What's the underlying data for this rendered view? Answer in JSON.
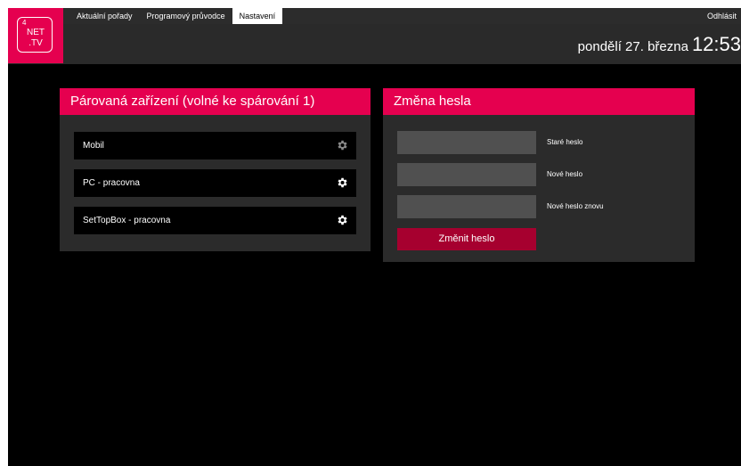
{
  "nav": {
    "tabs": [
      {
        "label": "Aktuální pořady"
      },
      {
        "label": "Programový průvodce"
      },
      {
        "label": "Nastavení"
      }
    ],
    "active_tab": "Nastavení",
    "logout_label": "Odhlásit"
  },
  "logo": {
    "number": "4",
    "line1": "NET",
    "line2": ".TV"
  },
  "clock": {
    "date": "pondělí 27. března",
    "time": "12:53"
  },
  "devices_panel": {
    "title": "Párovaná zařízení (volné ke spárování 1)",
    "devices": [
      {
        "label": "Mobil",
        "gear_state": "dimmed"
      },
      {
        "label": "PC - pracovna",
        "gear_state": "active"
      },
      {
        "label": "SetTopBox - pracovna",
        "gear_state": "active"
      }
    ]
  },
  "password_panel": {
    "title": "Změna hesla",
    "fields": [
      {
        "label": "Staré heslo",
        "value": ""
      },
      {
        "label": "Nové heslo",
        "value": ""
      },
      {
        "label": "Nové heslo znovu",
        "value": ""
      }
    ],
    "submit_label": "Změnit heslo"
  },
  "colors": {
    "accent": "#e5004f",
    "button": "#a6002f",
    "panel": "#2b2b2b",
    "background": "#000000"
  }
}
